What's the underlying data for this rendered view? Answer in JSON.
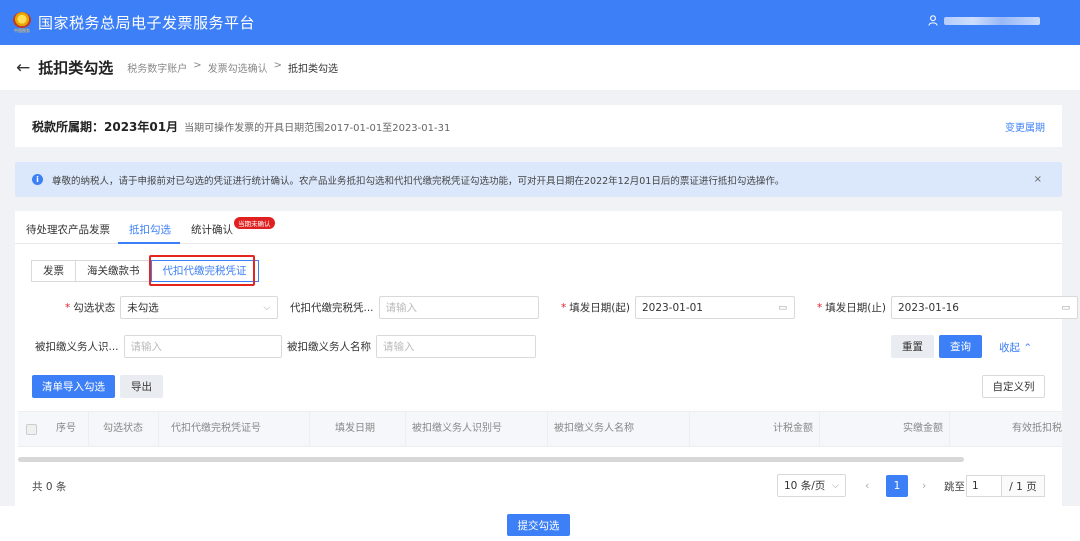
{
  "header": {
    "app_title": "国家税务总局电子发票服务平台",
    "logo_caption": "中国税务",
    "user_icon": "user-icon"
  },
  "breadcrumb": {
    "page_title": "抵扣类勾选",
    "items": [
      "税务数字账户",
      "发票勾选确认",
      "抵扣类勾选"
    ],
    "separator": ">"
  },
  "period": {
    "label": "税款所属期：2023年01月",
    "range_text": "当期可操作发票的开具日期范围2017-01-01至2023-01-31",
    "change_link": "变更属期"
  },
  "notice": {
    "text": "尊敬的纳税人，请于申报前对已勾选的凭证进行统计确认。农产品业务抵扣勾选和代扣代缴完税凭证勾选功能，可对开具日期在2022年12月01日后的票证进行抵扣勾选操作。",
    "close": "×"
  },
  "tabs": [
    {
      "label": "待处理农产品发票"
    },
    {
      "label": "抵扣勾选"
    },
    {
      "label": "统计确认"
    }
  ],
  "tab_badge": "当期未确认",
  "subtabs": [
    {
      "label": "发票"
    },
    {
      "label": "海关缴款书"
    },
    {
      "label": "代扣代缴完税凭证"
    }
  ],
  "filters": {
    "status_label": "勾选状态",
    "status_value": "未勾选",
    "cert_no_label": "代扣代缴完税凭...",
    "cert_no_placeholder": "请输入",
    "date_from_label": "填发日期(起)",
    "date_from_value": "2023-01-01",
    "date_to_label": "填发日期(止)",
    "date_to_value": "2023-01-16",
    "taxpayer_id_label": "被扣缴义务人识...",
    "taxpayer_id_placeholder": "请输入",
    "taxpayer_name_label": "被扣缴义务人名称",
    "taxpayer_name_placeholder": "请输入"
  },
  "actions": {
    "reset": "重置",
    "query": "查询",
    "collapse": "收起",
    "import_select": "清单导入勾选",
    "export": "导出",
    "custom_columns": "自定义列"
  },
  "table": {
    "columns": [
      "序号",
      "勾选状态",
      "代扣代缴完税凭证号",
      "填发日期",
      "被扣缴义务人识别号",
      "被扣缴义务人名称",
      "计税金额",
      "实缴金额",
      "有效抵扣税"
    ]
  },
  "pagination": {
    "total": "共 0 条",
    "page_size": "10 条/页",
    "current_page": "1",
    "jump_label": "跳至",
    "jump_value": "1",
    "total_pages": "/ 1 页"
  },
  "footer": {
    "submit": "提交勾选"
  },
  "colors": {
    "primary": "#3d7ff6",
    "highlight_box": "#e5261f",
    "badge": "#e02020",
    "notice_bg": "#dbe8fc"
  }
}
